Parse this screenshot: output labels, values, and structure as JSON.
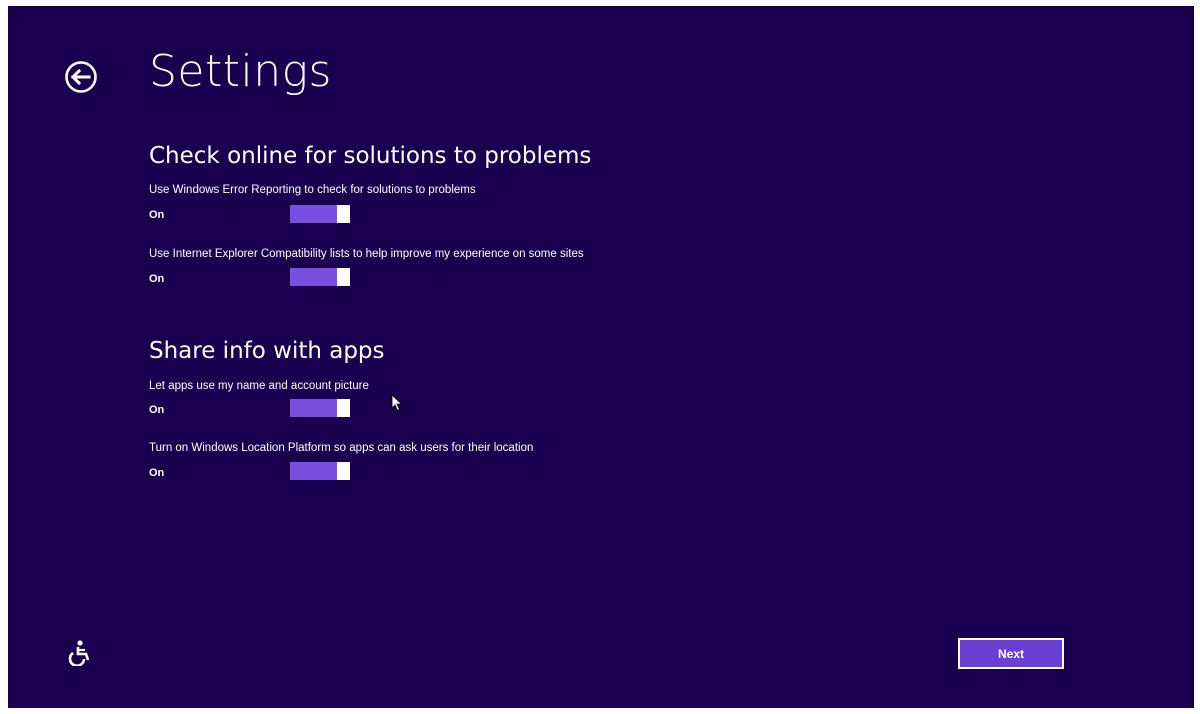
{
  "header": {
    "title": "Settings",
    "back_icon": "back-arrow-circle-icon"
  },
  "sections": [
    {
      "heading": "Check online for solutions to problems",
      "settings": [
        {
          "label": "Use Windows Error Reporting to check for solutions to problems",
          "state": "On",
          "enabled": true
        },
        {
          "label": "Use Internet Explorer Compatibility lists to help improve my experience on some sites",
          "state": "On",
          "enabled": true
        }
      ]
    },
    {
      "heading": "Share info with apps",
      "settings": [
        {
          "label": "Let apps use my name and account picture",
          "state": "On",
          "enabled": true
        },
        {
          "label": "Turn on Windows Location Platform so apps can ask users for their location",
          "state": "On",
          "enabled": true
        }
      ]
    }
  ],
  "footer": {
    "ease_of_access_icon": "ease-of-access-icon",
    "next_label": "Next"
  },
  "colors": {
    "background": "#1b004f",
    "accent": "#7a4fe0",
    "button": "#6b3fd4",
    "text": "#ffffff"
  }
}
